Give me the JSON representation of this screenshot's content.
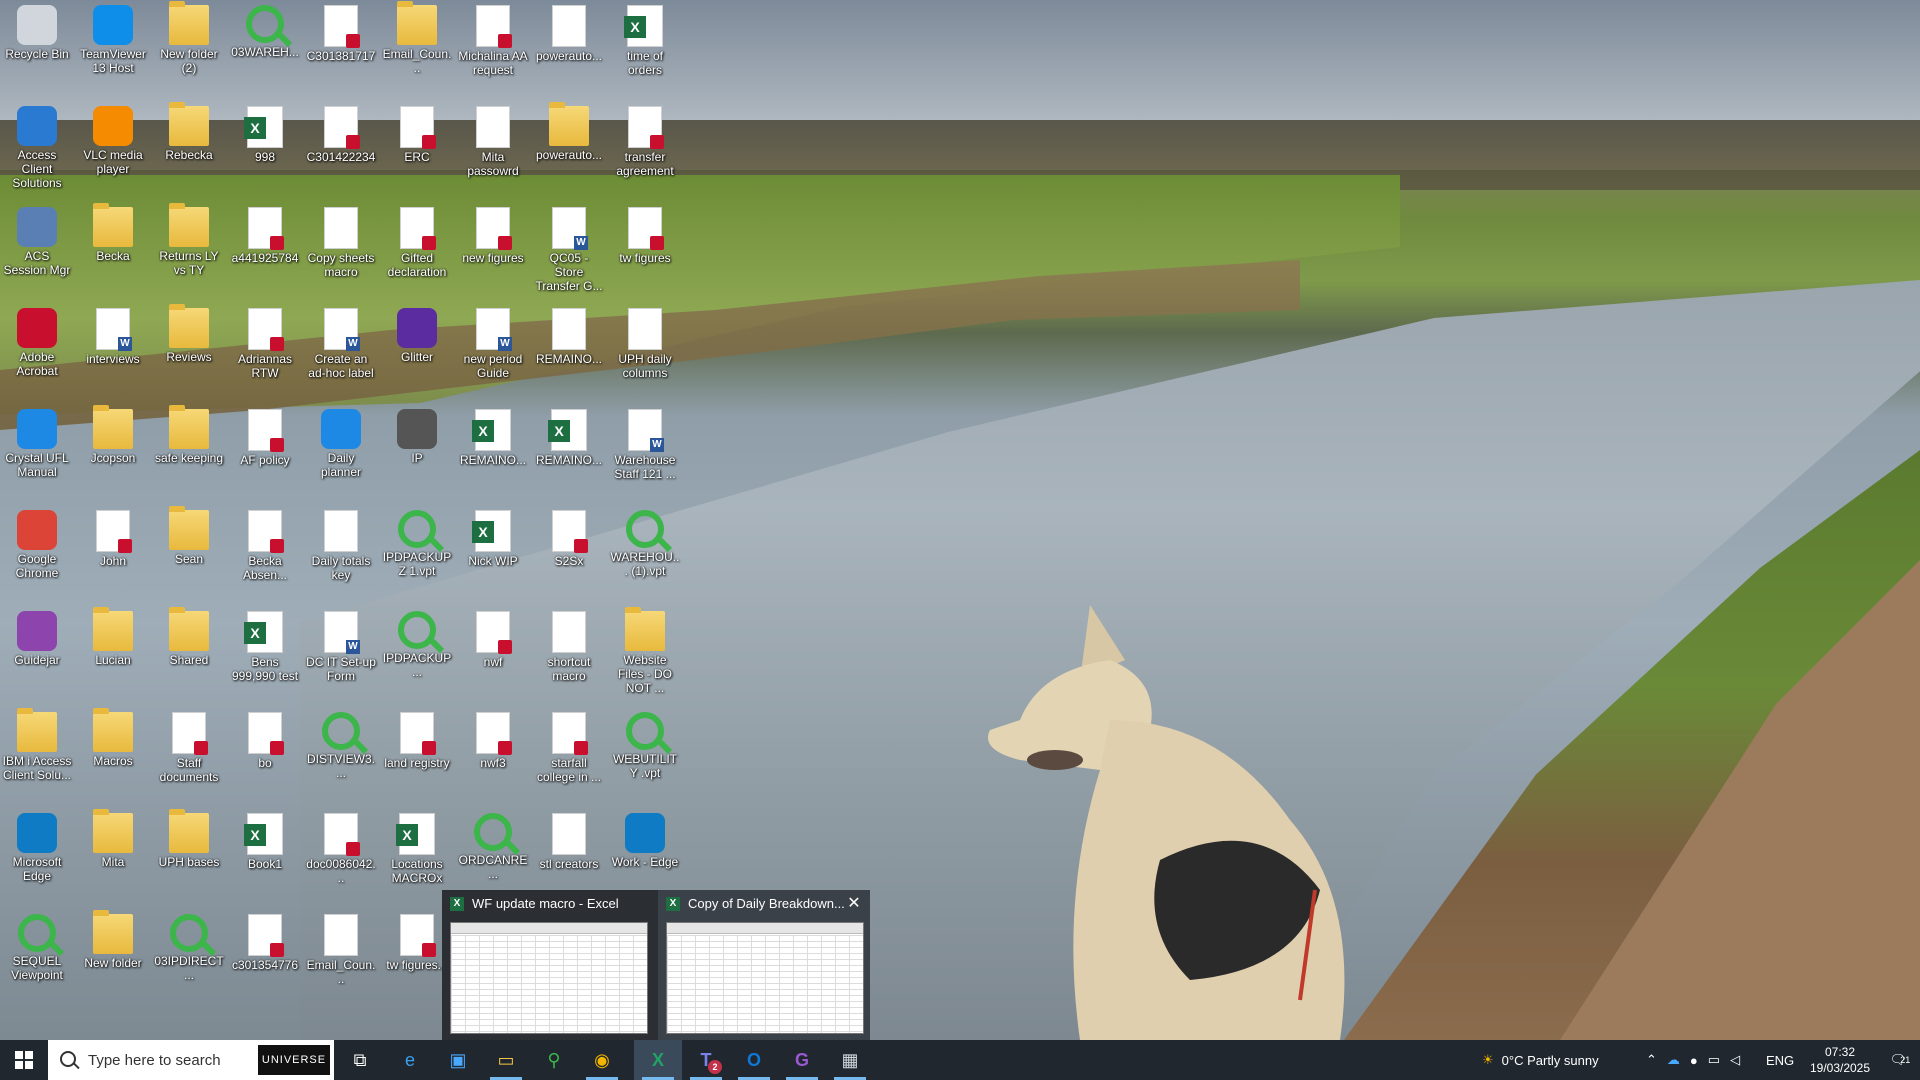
{
  "desktop": {
    "icons": [
      {
        "label": "Recycle Bin",
        "kind": "app",
        "color": "#d0d6dc"
      },
      {
        "label": "TeamViewer 13 Host",
        "kind": "app",
        "color": "#0e8ee9"
      },
      {
        "label": "New folder (2)",
        "kind": "folder"
      },
      {
        "label": "03WAREH...",
        "kind": "magnify"
      },
      {
        "label": "C301381717",
        "kind": "pdf"
      },
      {
        "label": "Email_Coun...",
        "kind": "folder"
      },
      {
        "label": "Michalina AA request",
        "kind": "pdf"
      },
      {
        "label": "powerauto...",
        "kind": "doc"
      },
      {
        "label": "time of orders",
        "kind": "xls"
      },
      {
        "label": "Access Client Solutions",
        "kind": "app",
        "color": "#2a7ad1"
      },
      {
        "label": "VLC media player",
        "kind": "app",
        "color": "#f48b00"
      },
      {
        "label": "Rebecka",
        "kind": "folder"
      },
      {
        "label": "998",
        "kind": "xls"
      },
      {
        "label": "C301422234",
        "kind": "pdf"
      },
      {
        "label": "ERC",
        "kind": "pdf"
      },
      {
        "label": "Mita passowrd",
        "kind": "doc"
      },
      {
        "label": "powerauto...",
        "kind": "folder"
      },
      {
        "label": "transfer agreement",
        "kind": "pdf"
      },
      {
        "label": "ACS Session Mgr",
        "kind": "app",
        "color": "#5a7fb5"
      },
      {
        "label": "Becka",
        "kind": "folder"
      },
      {
        "label": "Returns LY vs TY",
        "kind": "folder"
      },
      {
        "label": "a441925784",
        "kind": "pdf"
      },
      {
        "label": "Copy sheets macro",
        "kind": "doc"
      },
      {
        "label": "Gifted declaration",
        "kind": "pdf"
      },
      {
        "label": "new figures",
        "kind": "pdf"
      },
      {
        "label": "QC05 - Store Transfer G...",
        "kind": "word"
      },
      {
        "label": "tw figures",
        "kind": "pdf"
      },
      {
        "label": "Adobe Acrobat",
        "kind": "app",
        "color": "#c8102e"
      },
      {
        "label": "interviews",
        "kind": "word"
      },
      {
        "label": "Reviews",
        "kind": "folder"
      },
      {
        "label": "Adriannas RTW",
        "kind": "pdf"
      },
      {
        "label": "Create an ad-hoc label",
        "kind": "word"
      },
      {
        "label": "Glitter",
        "kind": "app",
        "color": "#5b2ca0"
      },
      {
        "label": "new period Guide",
        "kind": "word"
      },
      {
        "label": "REMAINO...",
        "kind": "doc"
      },
      {
        "label": "UPH daily columns",
        "kind": "doc"
      },
      {
        "label": "Crystal UFL Manual",
        "kind": "app",
        "color": "#1e88e5"
      },
      {
        "label": "Jcopson",
        "kind": "folder"
      },
      {
        "label": "safe keeping",
        "kind": "folder"
      },
      {
        "label": "AF policy",
        "kind": "pdf"
      },
      {
        "label": "Daily planner",
        "kind": "app",
        "color": "#1e88e5"
      },
      {
        "label": "IP",
        "kind": "app",
        "color": "#555555"
      },
      {
        "label": "REMAINO...",
        "kind": "xls"
      },
      {
        "label": "REMAINO...",
        "kind": "xls"
      },
      {
        "label": "Warehouse Staff 121 ...",
        "kind": "word"
      },
      {
        "label": "Google Chrome",
        "kind": "app",
        "color": "#db4437"
      },
      {
        "label": "John",
        "kind": "pdf"
      },
      {
        "label": "Sean",
        "kind": "folder"
      },
      {
        "label": "Becka Absen...",
        "kind": "pdf"
      },
      {
        "label": "Daily totals key",
        "kind": "doc"
      },
      {
        "label": "IPDPACKUPZ 1.vpt",
        "kind": "magnify"
      },
      {
        "label": "Nick WIP",
        "kind": "xls"
      },
      {
        "label": "S2Sx",
        "kind": "pdf"
      },
      {
        "label": "WAREHOU... (1).vpt",
        "kind": "magnify"
      },
      {
        "label": "Guidejar",
        "kind": "app",
        "color": "#8e44ad"
      },
      {
        "label": "Lucian",
        "kind": "folder"
      },
      {
        "label": "Shared",
        "kind": "folder"
      },
      {
        "label": "Bens 999,990 test",
        "kind": "xls"
      },
      {
        "label": "DC IT Set-up Form",
        "kind": "word"
      },
      {
        "label": "IPDPACKUP...",
        "kind": "magnify"
      },
      {
        "label": "nwf",
        "kind": "pdf"
      },
      {
        "label": "shortcut macro",
        "kind": "doc"
      },
      {
        "label": "Website Files - DO NOT ...",
        "kind": "folder"
      },
      {
        "label": "IBM i Access Client Solu...",
        "kind": "folder"
      },
      {
        "label": "Macros",
        "kind": "folder"
      },
      {
        "label": "Staff documents",
        "kind": "pdf"
      },
      {
        "label": "bo",
        "kind": "pdf"
      },
      {
        "label": "DISTVIEW3....",
        "kind": "magnify"
      },
      {
        "label": "land registry",
        "kind": "pdf"
      },
      {
        "label": "nwf3",
        "kind": "pdf"
      },
      {
        "label": "starfall college in ...",
        "kind": "pdf"
      },
      {
        "label": "WEBUTILITY .vpt",
        "kind": "magnify"
      },
      {
        "label": "Microsoft Edge",
        "kind": "app",
        "color": "#0f7bc4"
      },
      {
        "label": "Mita",
        "kind": "folder"
      },
      {
        "label": "UPH bases",
        "kind": "folder"
      },
      {
        "label": "Book1",
        "kind": "xls"
      },
      {
        "label": "doc0086042...",
        "kind": "pdf"
      },
      {
        "label": "Locations MACROx",
        "kind": "xls"
      },
      {
        "label": "ORDCANRE...",
        "kind": "magnify"
      },
      {
        "label": "stl creators",
        "kind": "doc"
      },
      {
        "label": "Work - Edge",
        "kind": "app",
        "color": "#0f7bc4"
      },
      {
        "label": "SEQUEL Viewpoint",
        "kind": "magnify"
      },
      {
        "label": "New folder",
        "kind": "folder"
      },
      {
        "label": "03IPDIRECT...",
        "kind": "magnify"
      },
      {
        "label": "c301354776",
        "kind": "pdf"
      },
      {
        "label": "Email_Coun...",
        "kind": "doc"
      },
      {
        "label": "tw figures...",
        "kind": "pdf"
      }
    ]
  },
  "preview": {
    "windows": [
      {
        "title": "WF update macro - Excel"
      },
      {
        "title": "Copy of Daily Breakdown..."
      }
    ],
    "close_label": "✕"
  },
  "taskbar": {
    "search_placeholder": "Type here to search",
    "search_badge": "UNIVERSE",
    "apps": [
      {
        "name": "task-view",
        "glyph": "⧉"
      },
      {
        "name": "edge",
        "glyph": "e"
      },
      {
        "name": "store",
        "glyph": "▣"
      },
      {
        "name": "file-explorer",
        "glyph": "▭"
      },
      {
        "name": "sequel",
        "glyph": "⚲"
      },
      {
        "name": "chrome",
        "glyph": "◉"
      },
      {
        "name": "excel",
        "glyph": "X"
      },
      {
        "name": "teams",
        "glyph": "T"
      },
      {
        "name": "outlook",
        "glyph": "O"
      },
      {
        "name": "glitter",
        "glyph": "G"
      },
      {
        "name": "app",
        "glyph": "▦"
      }
    ],
    "teams_badge": "2",
    "weather": "0°C  Partly sunny",
    "language": "ENG",
    "time": "07:32",
    "date": "19/03/2025",
    "notifications": "21"
  }
}
